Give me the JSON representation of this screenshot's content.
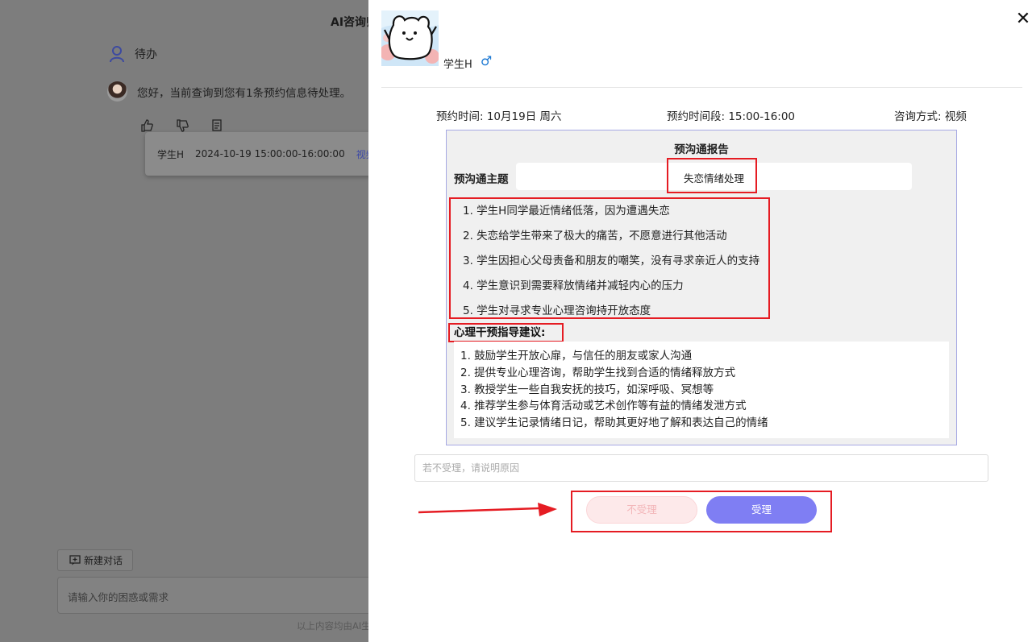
{
  "background": {
    "title": "AI咨询师",
    "todo_label": "待办",
    "message": "您好，当前查询到您有1条预约信息待处理。",
    "icons": [
      "thumbs-up-icon",
      "thumbs-down-icon",
      "copy-icon"
    ],
    "appointment_card": {
      "student": "学生H",
      "time": "2024-10-19 15:00:00-16:00:00",
      "mode": "视频"
    },
    "new_chat_label": "新建对话",
    "input_placeholder": "请输入你的困惑或需求",
    "footnote": "以上内容均由AI生"
  },
  "drawer": {
    "student_name": "学生H",
    "gender_symbol": "♂",
    "appointment_date": "预约时间: 10月19日 周六",
    "appointment_slot": "预约时间段: 15:00-16:00",
    "consult_mode": "咨询方式: 视频",
    "report": {
      "title": "预沟通报告",
      "topic_label": "预沟通主题",
      "topic_value": "失恋情绪处理",
      "points": [
        "1. 学生H同学最近情绪低落，因为遭遇失恋",
        "2. 失恋给学生带来了极大的痛苦，不愿意进行其他活动",
        "3. 学生因担心父母责备和朋友的嘲笑，没有寻求亲近人的支持",
        "4. 学生意识到需要释放情绪并减轻内心的压力",
        "5. 学生对寻求专业心理咨询持开放态度"
      ],
      "advice_title": "心理干预指导建议:",
      "advice": [
        "1. 鼓励学生开放心扉，与信任的朋友或家人沟通",
        "2. 提供专业心理咨询，帮助学生找到合适的情绪释放方式",
        "3. 教授学生一些自我安抚的技巧，如深呼吸、冥想等",
        "4. 推荐学生参与体育活动或艺术创作等有益的情绪发泄方式",
        "5. 建议学生记录情绪日记，帮助其更好地了解和表达自己的情绪"
      ]
    },
    "reason_placeholder": "若不受理，请说明原因",
    "reject_label": "不受理",
    "accept_label": "受理",
    "colors": {
      "accent": "#7f7ef3",
      "annotation_red": "#e51c23",
      "reject_bg": "#fde9ea",
      "gender_blue": "#1a77d2"
    }
  }
}
